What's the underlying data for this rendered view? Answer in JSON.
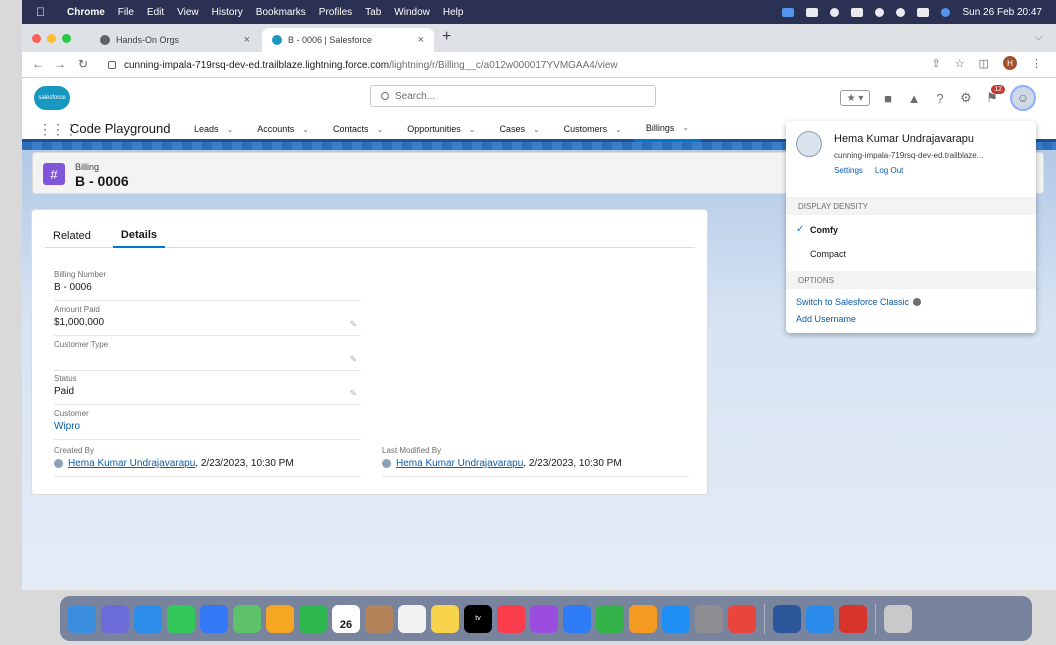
{
  "menubar": {
    "app": "Chrome",
    "items": [
      "File",
      "Edit",
      "View",
      "History",
      "Bookmarks",
      "Profiles",
      "Tab",
      "Window",
      "Help"
    ],
    "datetime": "Sun 26 Feb 20:47"
  },
  "browser": {
    "tabs": [
      {
        "title": "Hands-On Orgs",
        "close": "×",
        "fav_color": "#5f6368"
      },
      {
        "title": "B - 0006 | Salesforce",
        "close": "×",
        "fav_color": "#1798c1"
      }
    ],
    "new_tab": "+",
    "url_main": "cunning-impala-719rsq-dev-ed.trailblaze.lightning.force.com",
    "url_path": "/lightning/r/Billing__c/a012w000017YVMGAA4/view",
    "profile_initial": "H"
  },
  "header": {
    "logo_text": "salesforce",
    "search_placeholder": "Search...",
    "notification_count": "12"
  },
  "appnav": {
    "app_name": "Code Playground",
    "items": [
      {
        "label": "Leads"
      },
      {
        "label": "Accounts"
      },
      {
        "label": "Contacts"
      },
      {
        "label": "Opportunities"
      },
      {
        "label": "Cases"
      },
      {
        "label": "Customers"
      },
      {
        "label": "Billings"
      }
    ],
    "active_index": 6
  },
  "record": {
    "object": "Billing",
    "name": "B - 0006",
    "tabs": [
      "Related",
      "Details"
    ],
    "active_tab": "Details",
    "fields": {
      "billing_number": {
        "label": "Billing Number",
        "value": "B - 0006"
      },
      "amount_paid": {
        "label": "Amount Paid",
        "value": "$1,000,000"
      },
      "customer_type": {
        "label": "Customer Type",
        "value": ""
      },
      "status": {
        "label": "Status",
        "value": "Paid"
      },
      "customer": {
        "label": "Customer",
        "value": "Wipro"
      },
      "created_by": {
        "label": "Created By",
        "user": "Hema Kumar Undrajavarapu",
        "date": ", 2/23/2023, 10:30 PM"
      },
      "last_modified_by": {
        "label": "Last Modified By",
        "user": "Hema Kumar Undrajavarapu",
        "date": ", 2/23/2023, 10:30 PM"
      }
    }
  },
  "user_menu": {
    "name": "Hema Kumar Undrajavarapu",
    "username": "cunning-impala-719rsq-dev-ed.trailblaze...",
    "settings": "Settings",
    "logout": "Log Out",
    "density_header": "DISPLAY DENSITY",
    "density_options": [
      {
        "label": "Comfy",
        "selected": true
      },
      {
        "label": "Compact",
        "selected": false
      }
    ],
    "options_header": "OPTIONS",
    "switch_classic": "Switch to Salesforce Classic",
    "add_username": "Add Username"
  },
  "dock": {
    "calendar_day": "26",
    "tv_label": "tv",
    "apps": [
      {
        "icon": "finder-icon",
        "color": "#3b8de0"
      },
      {
        "icon": "launchpad-icon",
        "color": "#6c6cd9"
      },
      {
        "icon": "safari-icon",
        "color": "#2c8ee8"
      },
      {
        "icon": "messages-icon",
        "color": "#34c759"
      },
      {
        "icon": "mail-icon",
        "color": "#3478f6"
      },
      {
        "icon": "maps-icon",
        "color": "#5ec26a"
      },
      {
        "icon": "photos-icon",
        "color": "#f5a623"
      },
      {
        "icon": "facetime-icon",
        "color": "#2fb84f"
      },
      {
        "icon": "calendar-icon",
        "color": "#ffffff"
      },
      {
        "icon": "contacts-icon",
        "color": "#b5835a"
      },
      {
        "icon": "reminders-icon",
        "color": "#f2f2f2"
      },
      {
        "icon": "notes-icon",
        "color": "#f7d44c"
      },
      {
        "icon": "appletv-icon",
        "color": "#000000"
      },
      {
        "icon": "music-icon",
        "color": "#fa3c4c"
      },
      {
        "icon": "podcasts-icon",
        "color": "#9b4de0"
      },
      {
        "icon": "keynote-icon",
        "color": "#2d7cf6"
      },
      {
        "icon": "numbers-icon",
        "color": "#33b24a"
      },
      {
        "icon": "pages-icon",
        "color": "#f59a23"
      },
      {
        "icon": "appstore-icon",
        "color": "#1f8ef5"
      },
      {
        "icon": "systemprefs-icon",
        "color": "#8e8e93"
      },
      {
        "icon": "chrome-icon",
        "color": "#e8453c"
      },
      {
        "icon": "word-icon",
        "color": "#2b579a"
      },
      {
        "icon": "icloud-icon",
        "color": "#2a8bea"
      },
      {
        "icon": "photobooth-icon",
        "color": "#d9342b"
      },
      {
        "icon": "trash-icon",
        "color": "#c9c9c9"
      }
    ]
  }
}
